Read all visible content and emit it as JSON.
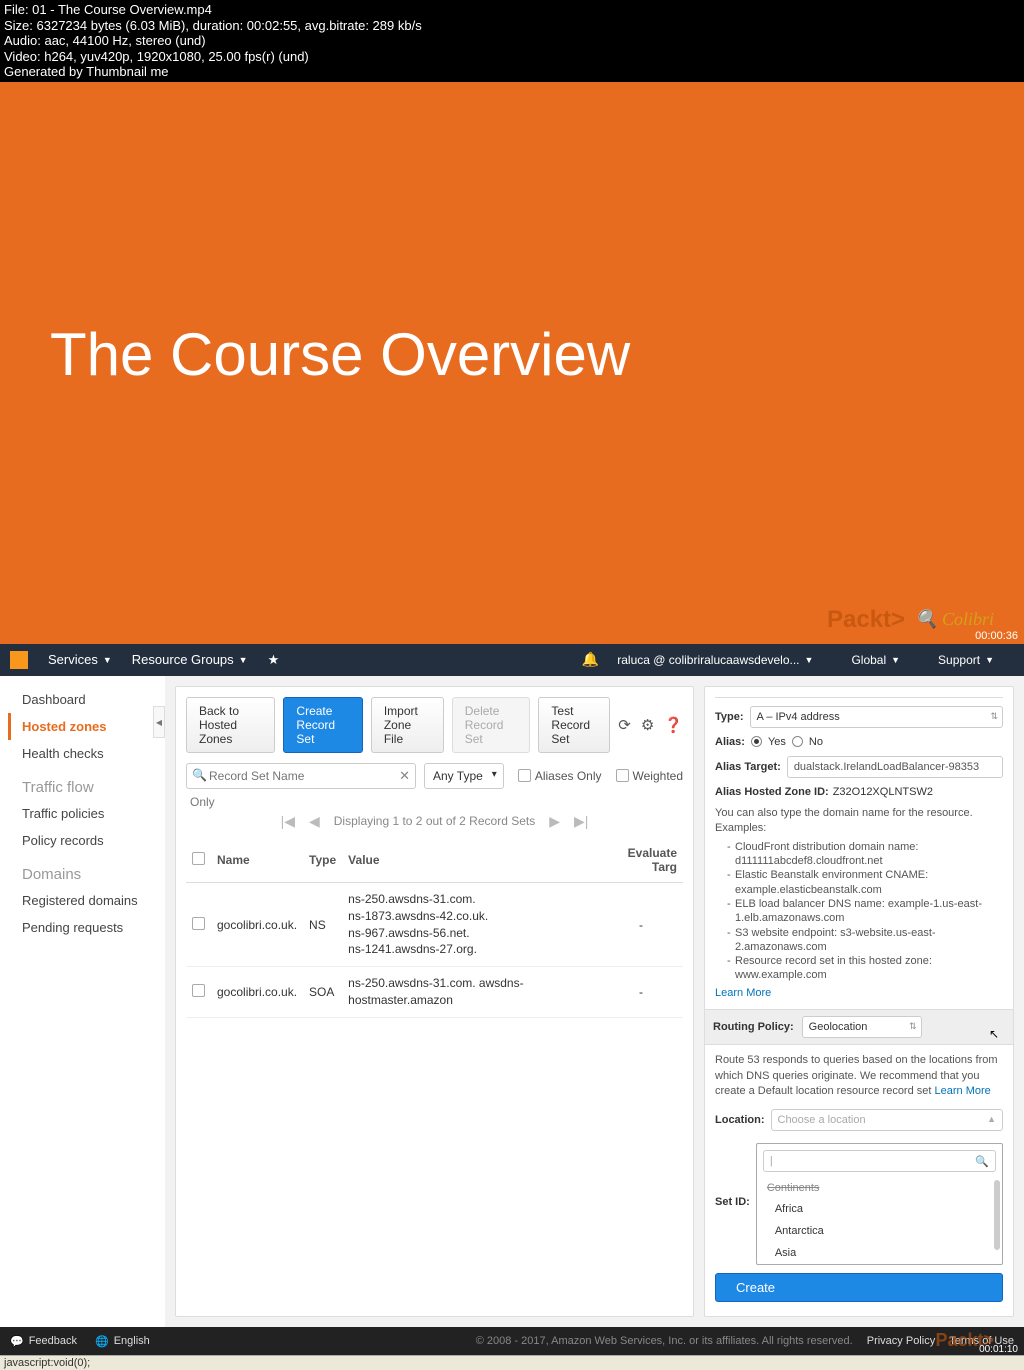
{
  "meta": {
    "l1": "File: 01 - The Course Overview.mp4",
    "l2": "Size: 6327234 bytes (6.03 MiB), duration: 00:02:55, avg.bitrate: 289 kb/s",
    "l3": "Audio: aac, 44100 Hz, stereo (und)",
    "l4": "Video: h264, yuv420p, 1920x1080, 25.00 fps(r) (und)",
    "l5": "Generated by Thumbnail me"
  },
  "slide": {
    "title": "The Course Overview",
    "brand": "Packt>",
    "time": "00:00:36"
  },
  "topbar": {
    "services": "Services",
    "rg": "Resource Groups",
    "user": "raluca @ colibriralucaawsdevelo...",
    "region": "Global",
    "support": "Support"
  },
  "nav": {
    "dashboard": "Dashboard",
    "hosted": "Hosted zones",
    "health": "Health checks",
    "traffic_head": "Traffic flow",
    "traffic_pol": "Traffic policies",
    "policy_rec": "Policy records",
    "domains_head": "Domains",
    "reg": "Registered domains",
    "pending": "Pending requests"
  },
  "buttons": {
    "back": "Back to Hosted Zones",
    "create": "Create Record Set",
    "import": "Import Zone File",
    "delete": "Delete Record Set",
    "test": "Test Record Set"
  },
  "filter": {
    "search_ph": "Record Set Name",
    "anytype": "Any Type",
    "aliases": "Aliases Only",
    "weighted": "Weighted",
    "only": "Only",
    "pager": "Displaying 1 to 2 out of 2 Record Sets"
  },
  "table": {
    "h_name": "Name",
    "h_type": "Type",
    "h_value": "Value",
    "h_eval": "Evaluate Targ",
    "rows": [
      {
        "name": "gocolibri.co.uk.",
        "type": "NS",
        "values": [
          "ns-250.awsdns-31.com.",
          "ns-1873.awsdns-42.co.uk.",
          "ns-967.awsdns-56.net.",
          "ns-1241.awsdns-27.org."
        ],
        "eval": "-"
      },
      {
        "name": "gocolibri.co.uk.",
        "type": "SOA",
        "values": [
          "ns-250.awsdns-31.com. awsdns-hostmaster.amazon"
        ],
        "eval": "-"
      }
    ]
  },
  "detail": {
    "type_label": "Type:",
    "type_value": "A – IPv4 address",
    "alias_label": "Alias:",
    "yes": "Yes",
    "no": "No",
    "alias_target_label": "Alias Target:",
    "alias_target_value": "dualstack.IrelandLoadBalancer-98353",
    "hosted_zone_label": "Alias Hosted Zone ID:",
    "hosted_zone_value": "Z32O12XQLNTSW2",
    "hint_intro": "You can also type the domain name for the resource. Examples:",
    "hints": [
      "CloudFront distribution domain name: d111111abcdef8.cloudfront.net",
      "Elastic Beanstalk environment CNAME: example.elasticbeanstalk.com",
      "ELB load balancer DNS name: example-1.us-east-1.elb.amazonaws.com",
      "S3 website endpoint: s3-website.us-east-2.amazonaws.com",
      "Resource record set in this hosted zone: www.example.com"
    ],
    "learn_more": "Learn More",
    "routing_label": "Routing Policy:",
    "routing_value": "Geolocation",
    "routing_hint": "Route 53 responds to queries based on the locations from which DNS queries originate. We recommend that you create a Default location resource record set",
    "location_label": "Location:",
    "location_placeholder": "Choose a location",
    "setid_label": "Set ID:",
    "dd_group": "Continents",
    "dd_items": [
      "Africa",
      "Antarctica",
      "Asia"
    ],
    "create": "Create"
  },
  "footer": {
    "feedback": "Feedback",
    "english": "English",
    "copy": "© 2008 - 2017, Amazon Web Services, Inc. or its affiliates. All rights reserved.",
    "privacy": "Privacy Policy",
    "terms": "Terms of Use",
    "packt": "Packt>",
    "time": "00:01:10",
    "status": "javascript:void(0);"
  }
}
